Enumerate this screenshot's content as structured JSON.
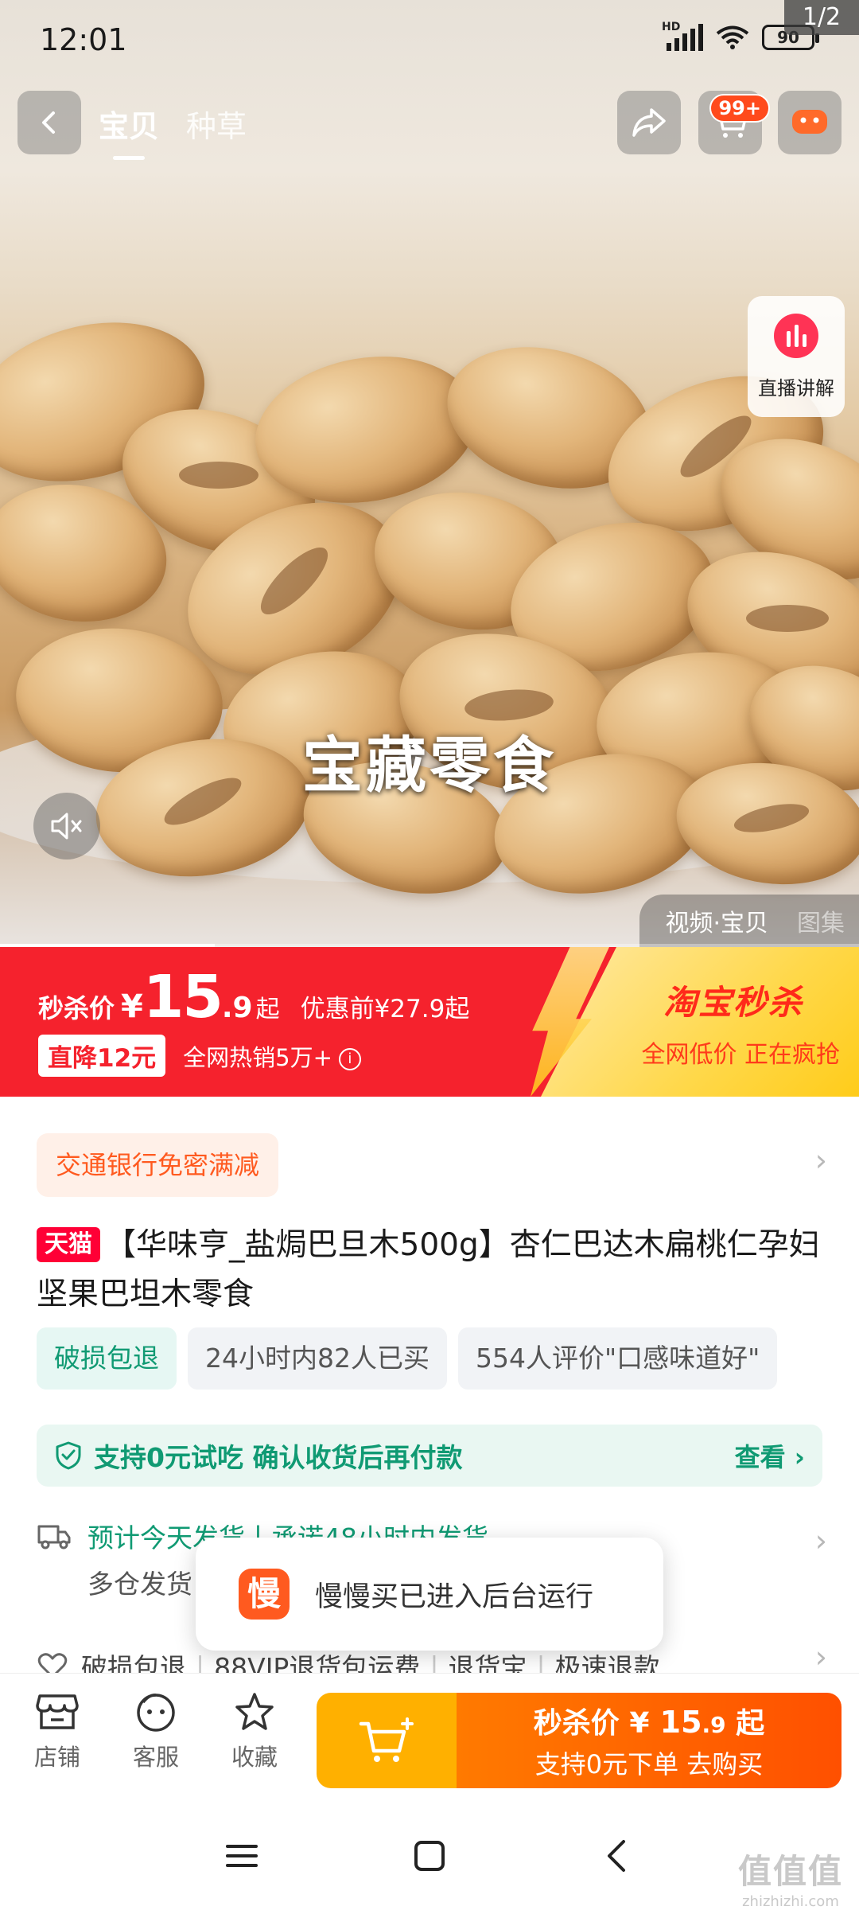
{
  "status_bar": {
    "time": "12:01",
    "network": "HD",
    "battery": "90",
    "media_page": "1/2"
  },
  "top_nav": {
    "tabs": [
      {
        "label": "宝贝",
        "active": true
      },
      {
        "label": "种草",
        "active": false
      }
    ],
    "cart_badge": "99+"
  },
  "media": {
    "live_label": "直播讲解",
    "caption": "宝藏零食",
    "switch_items": [
      {
        "label": "视频·宝贝",
        "active": true
      },
      {
        "label": "图集",
        "active": false
      }
    ],
    "progress_fraction": 0.25
  },
  "promo": {
    "price_label": "秒杀价",
    "currency": "¥",
    "price_int": "15",
    "price_dec": ".9",
    "price_suffix": "起",
    "original_price": "优惠前¥27.9起",
    "drop_tag": "直降12元",
    "hot_sales": "全网热销5万+",
    "info_symbol": "i",
    "brand": "淘宝秒杀",
    "brand_sub": "全网低价 正在疯抢",
    "colors": {
      "primary": "#f5222d",
      "accent": "#ffd84a"
    }
  },
  "product": {
    "bank_offer": "交通银行免密满减",
    "store_badge": "天猫",
    "title": "【华味亨_盐焗巴旦木500g】杏仁巴达木扁桃仁孕妇坚果巴坦木零食",
    "tags": [
      "破损包退",
      "24小时内82人已买",
      "554人评价\"口感味道好\""
    ],
    "guarantee": {
      "text": "支持0元试吃 确认收货后再付款",
      "link": "查看 ›"
    },
    "shipping": {
      "line1": "预计今天发货丨承诺48小时内发货",
      "line2": "多仓发货"
    },
    "services": [
      "破损包退",
      "88VIP退货包运费",
      "退货宝",
      "极速退款"
    ]
  },
  "toast": {
    "icon_char": "慢",
    "text": "慢慢买已进入后台运行"
  },
  "bottom_bar": {
    "items": [
      {
        "label": "店铺",
        "icon": "store-icon"
      },
      {
        "label": "客服",
        "icon": "service-icon"
      },
      {
        "label": "收藏",
        "icon": "star-icon"
      }
    ],
    "buy": {
      "label": "秒杀价",
      "currency": "¥",
      "price_int": " 15",
      "price_dec": ".9",
      "suffix": " 起",
      "line2": "支持0元下单 去购买"
    }
  },
  "watermark": {
    "big": "值值值",
    "small": "zhizhizhi.com"
  }
}
